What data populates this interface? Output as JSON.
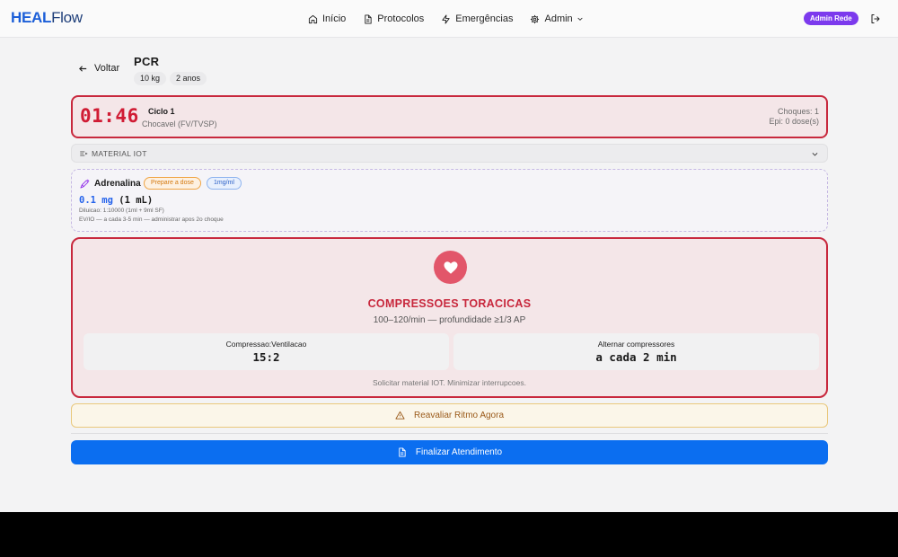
{
  "header": {
    "logo_primary": "HEAL",
    "logo_secondary": "Flow",
    "nav": [
      {
        "label": "Início",
        "icon": "home-icon"
      },
      {
        "label": "Protocolos",
        "icon": "document-icon"
      },
      {
        "label": "Emergências",
        "icon": "lightning-icon"
      },
      {
        "label": "Admin",
        "icon": "gear-icon"
      }
    ],
    "user_badge": "Admin Rede"
  },
  "page": {
    "back_label": "Voltar",
    "title": "PCR",
    "tags": [
      "10 kg",
      "2 anos"
    ]
  },
  "timer_card": {
    "time": "01:46",
    "cycle": "Ciclo 1",
    "rhythm": "Chocavel (FV/TVSP)",
    "shocks": "Choques: 1",
    "epi": "Epi: 0 dose(s)"
  },
  "material": {
    "label": "MATERIAL IOT"
  },
  "drug": {
    "name": "Adrenalina",
    "prepare_badge": "Prepare a dose",
    "concentration_badge": "1mg/ml",
    "dose_mg": "0.1 mg",
    "dose_ml": "(1 mL)",
    "dilution": "Diluicao: 1:10000 (1ml + 9ml SF)",
    "route": "EV/IO — a cada 3-5 min — administrar apos 2o choque"
  },
  "compressions": {
    "title": "COMPRESSOES TORACICAS",
    "subtitle": "100–120/min — profundidade ≥1/3 AP",
    "stats": [
      {
        "label": "Compressao:Ventilacao",
        "value": "15:2"
      },
      {
        "label": "Alternar compressores",
        "value": "a cada 2 min"
      }
    ],
    "note": "Solicitar material IOT. Minimizar interrupcoes."
  },
  "actions": {
    "reassess": "Reavaliar Ritmo Agora",
    "finish": "Finalizar Atendimento"
  },
  "colors": {
    "accent": "#0b6ef0",
    "alert": "#c8283d",
    "admin_badge": "#7c3aed",
    "warning": "#e9c87c"
  }
}
